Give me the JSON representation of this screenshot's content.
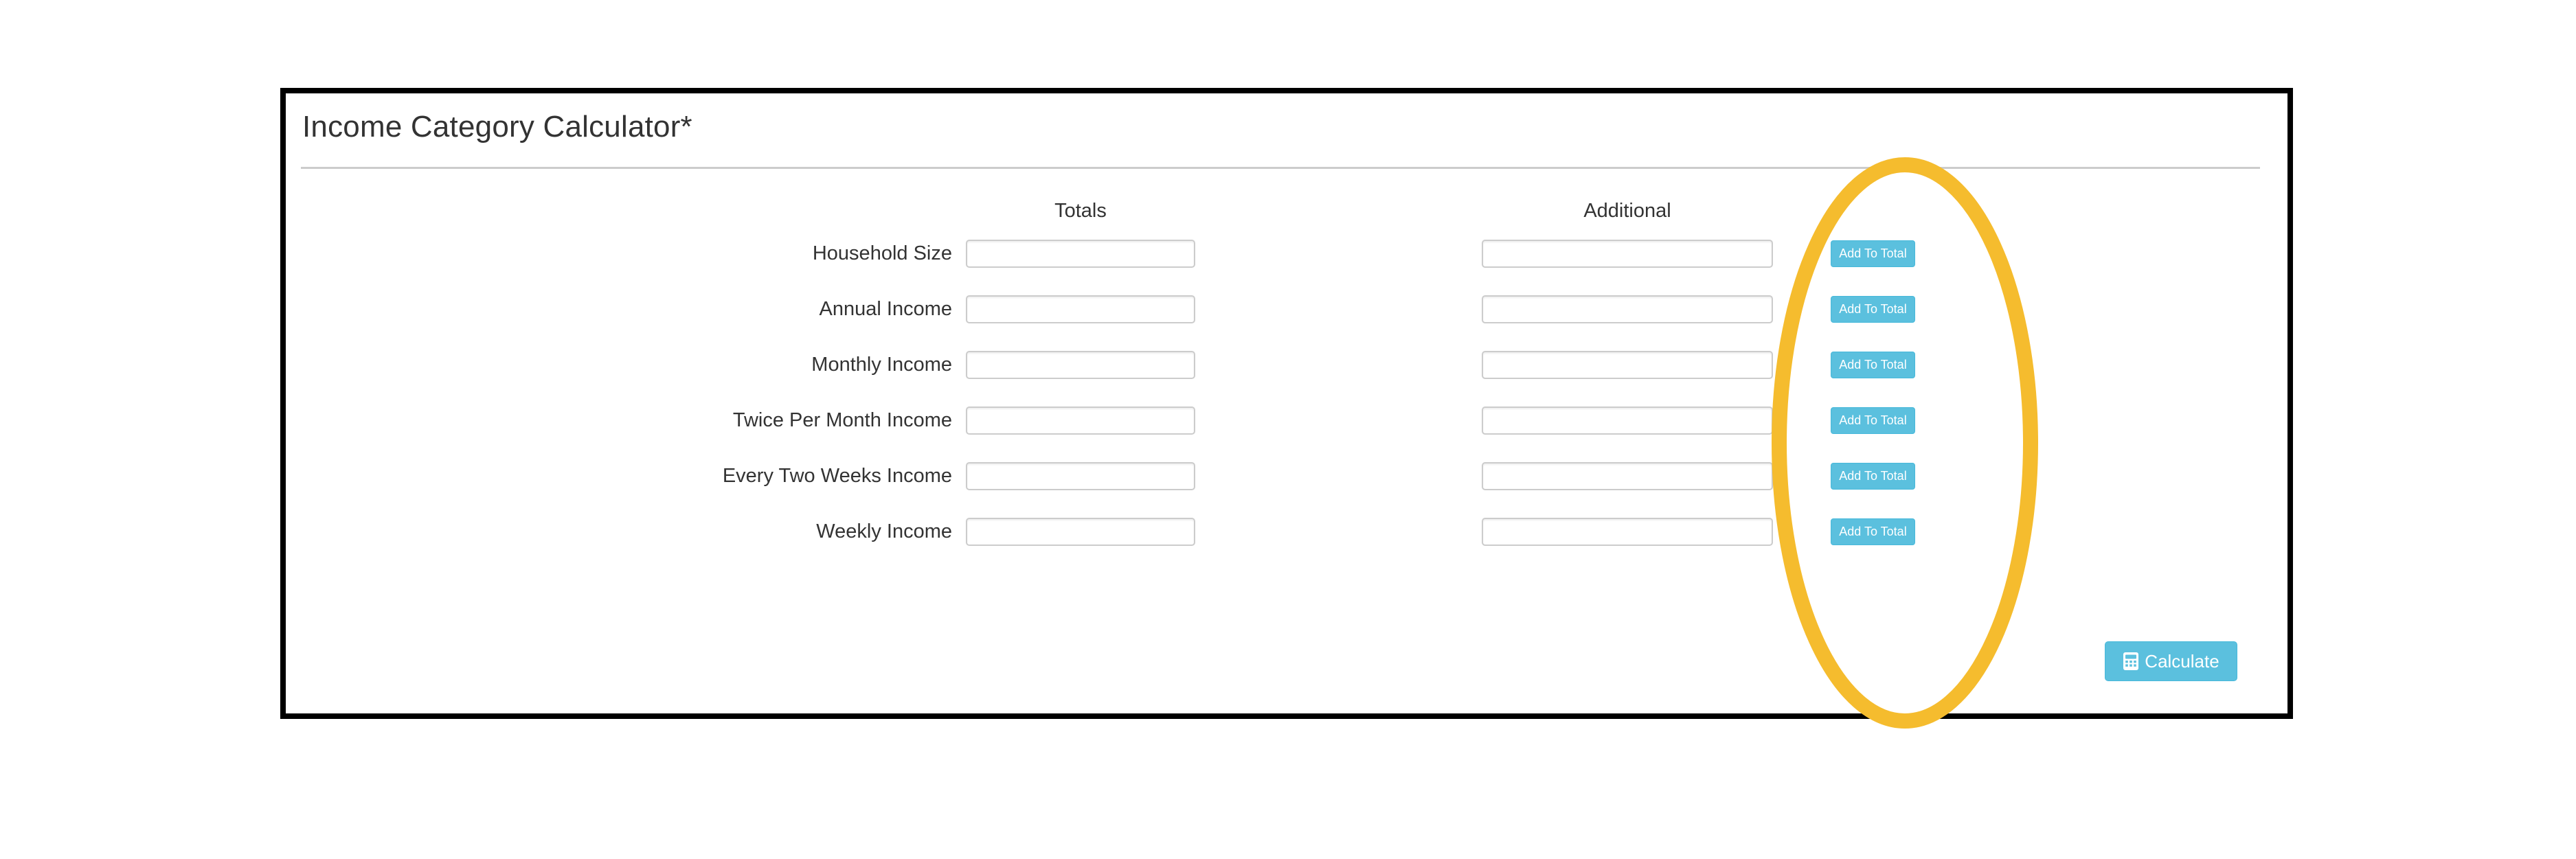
{
  "card": {
    "title": "Income Category Calculator*",
    "column_headers": {
      "totals": "Totals",
      "additional": "Additional"
    },
    "rows": [
      {
        "label": "Household Size",
        "totals_value": "",
        "totals_placeholder": "",
        "additional_value": "",
        "additional_placeholder": "",
        "button_label": "Add To Total"
      },
      {
        "label": "Annual Income",
        "totals_value": "",
        "totals_placeholder": "",
        "additional_value": "",
        "additional_placeholder": "",
        "button_label": "Add To Total"
      },
      {
        "label": "Monthly Income",
        "totals_value": "",
        "totals_placeholder": "",
        "additional_value": "",
        "additional_placeholder": "",
        "button_label": "Add To Total"
      },
      {
        "label": "Twice Per Month Income",
        "totals_value": "",
        "totals_placeholder": "",
        "additional_value": "",
        "additional_placeholder": "",
        "button_label": "Add To Total"
      },
      {
        "label": "Every Two Weeks Income",
        "totals_value": "",
        "totals_placeholder": "",
        "additional_value": "",
        "additional_placeholder": "",
        "button_label": "Add To Total"
      },
      {
        "label": "Weekly Income",
        "totals_value": "",
        "totals_placeholder": "",
        "additional_value": "",
        "additional_placeholder": "",
        "button_label": "Add To Total"
      }
    ],
    "calculate": {
      "label": "Calculate",
      "icon": "calculator-icon"
    },
    "clipped_note": ""
  },
  "annotations": {
    "highlight_ellipse": {
      "shape": "ellipse",
      "color": "#F5BC2E",
      "stroke_width": 22,
      "target": "add-to-total-button-column"
    },
    "frame": {
      "shape": "rectangle",
      "color": "#000000",
      "stroke_width": 8
    }
  },
  "colors": {
    "button_blue": "#5bc0de",
    "button_blue_border": "#46b8da",
    "text_dark": "#333333",
    "input_border": "#cccccc",
    "rule": "#cccccc",
    "annotation_gold": "#F5BC2E",
    "annotation_black": "#000000",
    "page_background": "#ffffff"
  }
}
